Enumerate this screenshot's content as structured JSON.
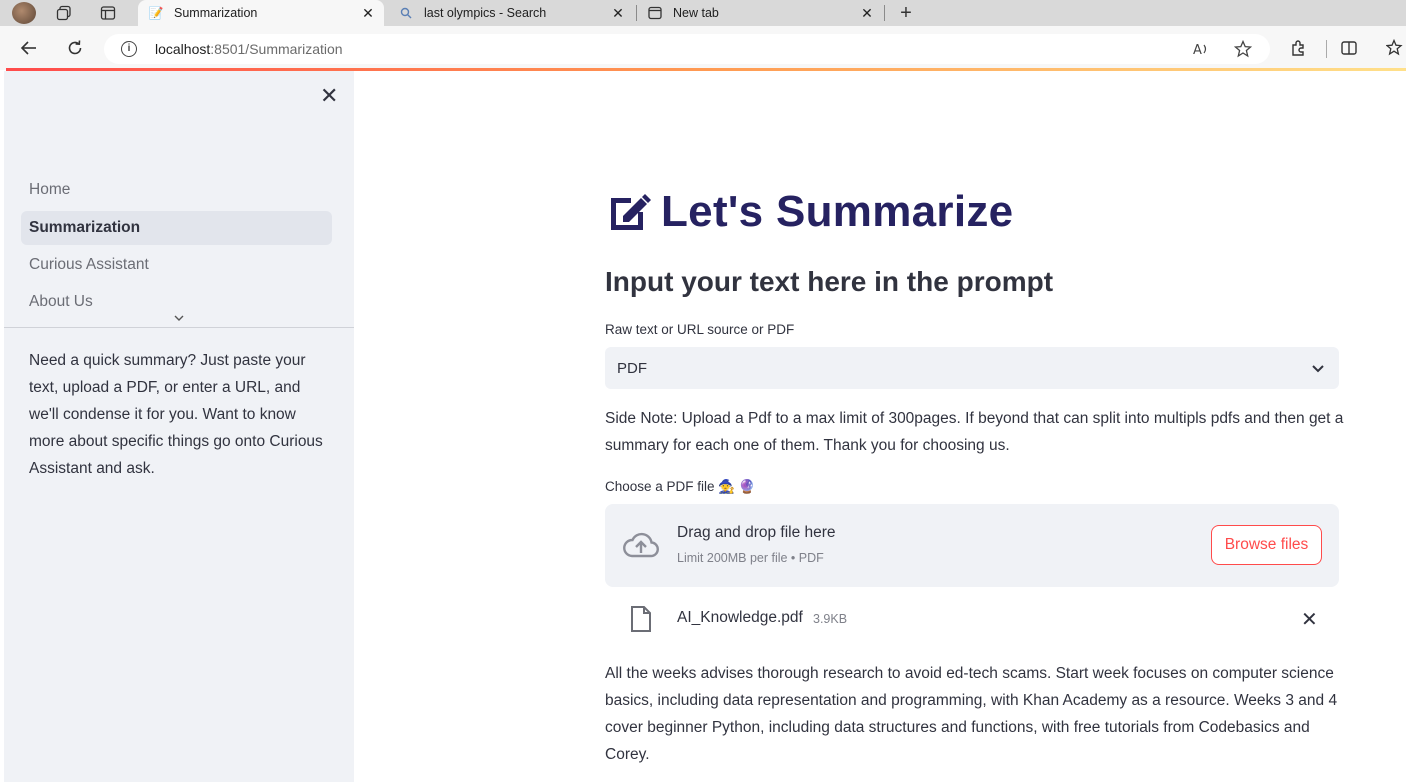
{
  "browser": {
    "tabs": [
      {
        "title": "Summarization",
        "icon": "notepad-icon",
        "active": true
      },
      {
        "title": "last olympics - Search",
        "icon": "search-icon",
        "active": false
      },
      {
        "title": "New tab",
        "icon": "newtab-icon",
        "active": false
      }
    ],
    "new_tab_symbol": "+",
    "address": {
      "host": "localhost",
      "path": ":8501/Summarization"
    }
  },
  "sidebar": {
    "close_symbol": "✕",
    "nav": [
      {
        "label": "Home",
        "active": false
      },
      {
        "label": "Summarization",
        "active": true
      },
      {
        "label": "Curious Assistant",
        "active": false
      },
      {
        "label": "About Us",
        "active": false
      }
    ],
    "description": "Need a quick summary? Just paste your text, upload a PDF, or enter a URL, and we'll condense it for you. Want to know more about specific things go onto Curious Assistant and ask."
  },
  "main": {
    "title": "Let's Summarize",
    "subtitle": "Input your text here in the prompt",
    "source_label": "Raw text or URL source or PDF",
    "source_value": "PDF",
    "side_note": "Side Note: Upload a Pdf to a max limit of 300pages. If beyond that can split into multipls pdfs and then get a summary for each one of them. Thank you for choosing us.",
    "uploader_label": "Choose a PDF file",
    "uploader_emojis": "🧙 🔮",
    "dropzone_title": "Drag and drop file here",
    "dropzone_sub": "Limit 200MB per file • PDF",
    "browse_label": "Browse files",
    "file": {
      "name": "AI_Knowledge.pdf",
      "size": "3.9KB"
    },
    "summary": "All the weeks advises thorough research to avoid ed-tech scams. Start week focuses on computer science basics, including data representation and programming, with Khan Academy as a resource. Weeks 3 and 4 cover beginner Python, including data structures and functions, with free tutorials from Codebasics and Corey."
  },
  "colors": {
    "accent": "#ff4b4b",
    "title": "#262261",
    "sidebar_bg": "#f0f2f6",
    "text": "#31333f"
  }
}
